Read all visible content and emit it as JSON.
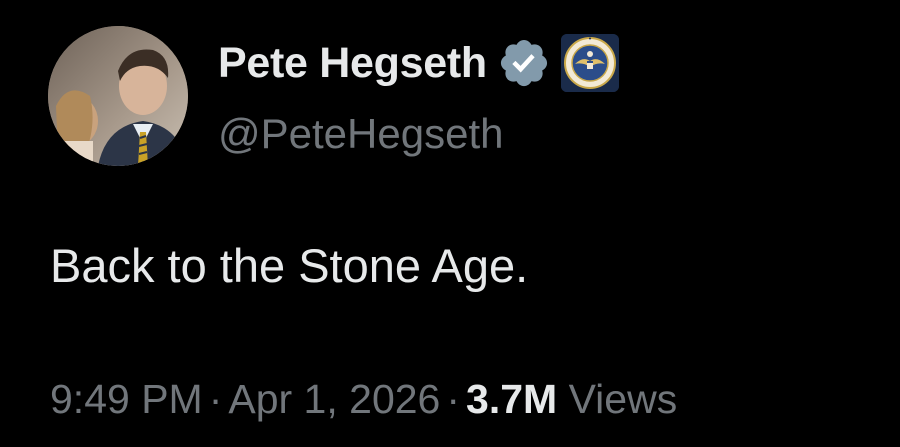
{
  "author": {
    "display_name": "Pete Hegseth",
    "handle": "@PeteHegseth",
    "verified_icon": "verified-badge-icon",
    "affiliate_icon": "department-of-defense-seal-icon",
    "verified_color": "#829aab"
  },
  "tweet": {
    "text": "Back to the Stone Age."
  },
  "meta": {
    "time": "9:49 PM",
    "separator": "·",
    "date": "Apr 1, 2026",
    "views_count": "3.7M",
    "views_label": "Views"
  },
  "colors": {
    "background": "#000000",
    "primary_text": "#e7e9ea",
    "secondary_text": "#71767b"
  }
}
